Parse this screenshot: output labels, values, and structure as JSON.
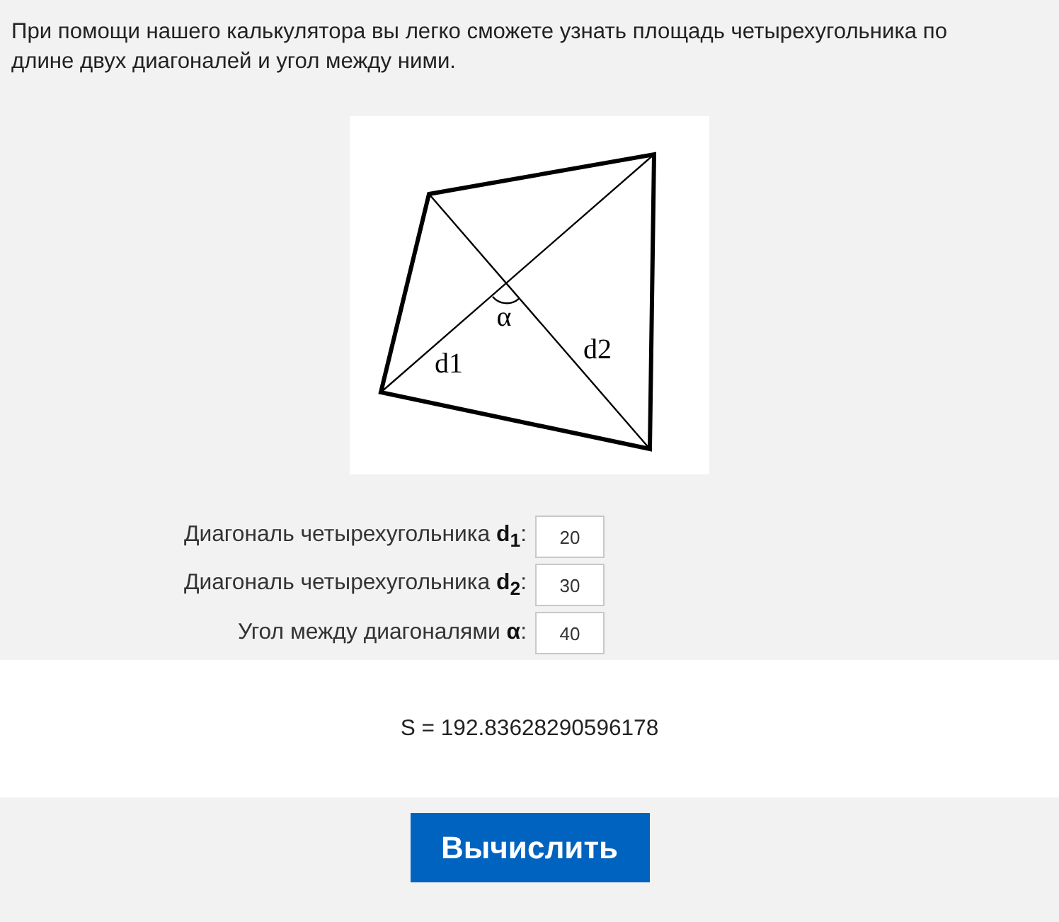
{
  "intro": "При помощи нашего калькулятора вы легко сможете узнать площадь четырехугольника по длине двух диагоналей и угол между ними.",
  "figure": {
    "labels": [
      "α",
      "d1",
      "d2"
    ]
  },
  "fields": [
    {
      "label": "Диагональ четырехугольника **d**$_{1}$:",
      "value": "20"
    },
    {
      "label": "Диагональ четырехугольника **d**$_{2}$:",
      "value": "30"
    },
    {
      "label": "Угол между диагоналями **α**:",
      "value": "40"
    }
  ],
  "result": "S = 192.83628290596178",
  "button": "Вычислить"
}
